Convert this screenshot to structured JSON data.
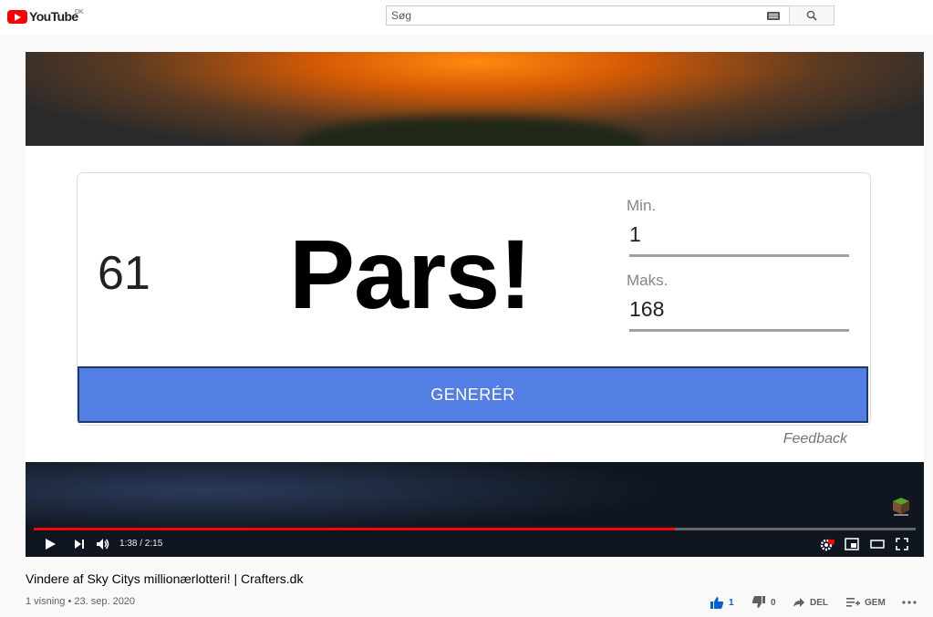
{
  "header": {
    "logo_text": "YouTube",
    "region": "DK",
    "search_placeholder": "Søg"
  },
  "widget": {
    "number": "61",
    "result_text": "Pars!",
    "min_label": "Min.",
    "min_value": "1",
    "max_label": "Maks.",
    "max_value": "168",
    "generate_label": "GENERÉR",
    "feedback_label": "Feedback"
  },
  "player": {
    "time": "1:38 / 2:15",
    "progress_fraction": 0.727
  },
  "video": {
    "title": "Vindere af Sky Citys millionærlotteri! | Crafters.dk",
    "meta": "1 visning • 23. sep. 2020",
    "likes": "1",
    "dislikes": "0",
    "share_label": "DEL",
    "save_label": "GEM"
  },
  "colors": {
    "accent_red": "#ff0000",
    "like_blue": "#065fd4",
    "generate_button": "#537ee3"
  }
}
